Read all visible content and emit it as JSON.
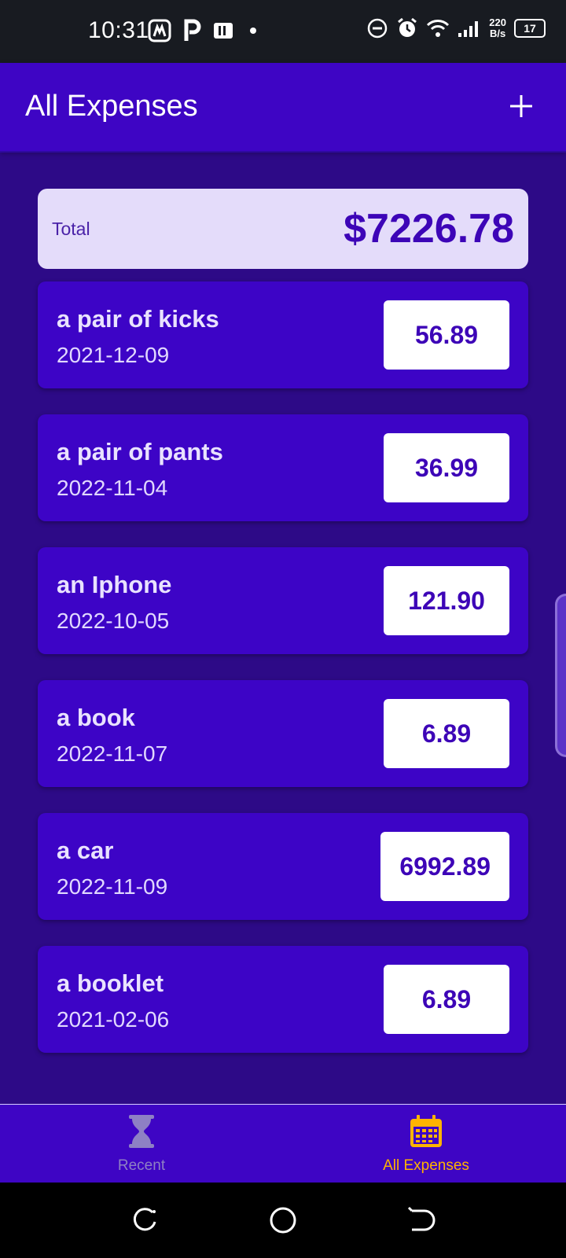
{
  "status_bar": {
    "time": "10:31",
    "net_speed_value": "220",
    "net_speed_unit": "B/s",
    "battery": "17",
    "left_icons": [
      "gallery-icon",
      "p-app-icon",
      "pdf-app-icon",
      "dot-icon"
    ],
    "right_icons": [
      "do-not-disturb-icon",
      "alarm-icon",
      "wifi-icon",
      "signal-icon",
      "battery-icon"
    ]
  },
  "header": {
    "title": "All Expenses",
    "add_icon": "plus-icon"
  },
  "summary": {
    "label": "Total",
    "total": "$7226.78"
  },
  "expenses": [
    {
      "title": "a pair of kicks",
      "date": "2021-12-09",
      "amount": "56.89"
    },
    {
      "title": "a pair of pants",
      "date": "2022-11-04",
      "amount": "36.99"
    },
    {
      "title": "an Iphone",
      "date": "2022-10-05",
      "amount": "121.90"
    },
    {
      "title": "a book",
      "date": "2022-11-07",
      "amount": "6.89"
    },
    {
      "title": "a car",
      "date": "2022-11-09",
      "amount": "6992.89"
    },
    {
      "title": "a booklet",
      "date": "2021-02-06",
      "amount": "6.89"
    }
  ],
  "bottom_nav": {
    "items": [
      {
        "label": "Recent",
        "icon": "hourglass-icon",
        "active": false
      },
      {
        "label": "All Expenses",
        "icon": "calendar-icon",
        "active": true
      }
    ]
  },
  "colors": {
    "header": "#3e05c4",
    "background": "#2d0a87",
    "accent_active": "#ffb300",
    "amount_text": "#3d05b7",
    "summary_bg": "#e4dcfa"
  }
}
